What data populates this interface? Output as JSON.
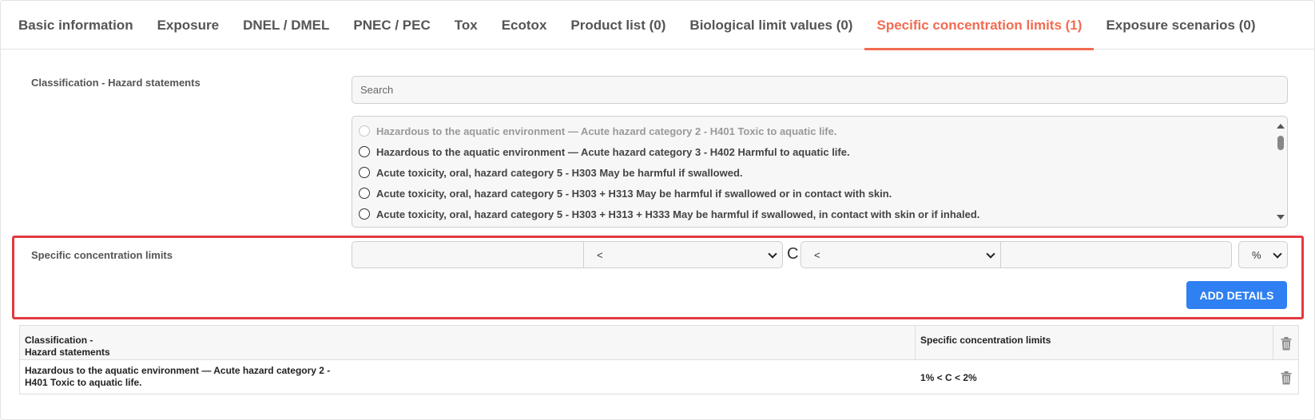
{
  "tabs": [
    {
      "label": "Basic information",
      "active": false
    },
    {
      "label": "Exposure",
      "active": false
    },
    {
      "label": "DNEL / DMEL",
      "active": false
    },
    {
      "label": "PNEC / PEC",
      "active": false
    },
    {
      "label": "Tox",
      "active": false
    },
    {
      "label": "Ecotox",
      "active": false
    },
    {
      "label": "Product list (0)",
      "active": false
    },
    {
      "label": "Biological limit values (0)",
      "active": false
    },
    {
      "label": "Specific concentration limits (1)",
      "active": true
    },
    {
      "label": "Exposure scenarios (0)",
      "active": false
    }
  ],
  "classification": {
    "label": "Classification - Hazard statements",
    "search_placeholder": "Search",
    "options": [
      {
        "text": "Hazardous to the aquatic environment — Acute hazard category 2 - H401 Toxic to aquatic life.",
        "disabled": true
      },
      {
        "text": "Hazardous to the aquatic environment — Acute hazard category 3 - H402 Harmful to aquatic life.",
        "disabled": false
      },
      {
        "text": "Acute toxicity, oral, hazard category 5 - H303 May be harmful if swallowed.",
        "disabled": false
      },
      {
        "text": "Acute toxicity, oral, hazard category 5 - H303 + H313 May be harmful if swallowed or in contact with skin.",
        "disabled": false
      },
      {
        "text": "Acute toxicity, oral, hazard category 5 - H303 + H313 + H333 May be harmful if swallowed, in contact with skin or if inhaled.",
        "disabled": false
      }
    ]
  },
  "limits": {
    "label": "Specific concentration limits",
    "lower_value": "",
    "lower_operator": "<",
    "c_label": "C",
    "upper_operator": "<",
    "upper_value": "",
    "unit": "%",
    "add_button": "ADD DETAILS"
  },
  "table": {
    "headers": {
      "classification_line1": "Classification -",
      "classification_line2": "Hazard statements",
      "limits": "Specific concentration limits"
    },
    "rows": [
      {
        "classification_line1": "Hazardous to the aquatic environment — Acute hazard category 2 -",
        "classification_line2": "H401 Toxic to aquatic life.",
        "limits": "1% < C < 2%"
      }
    ]
  },
  "icons": {
    "radio": "radio-icon",
    "trash": "trash-icon",
    "dropdown": "chevron-down-icon"
  },
  "colors": {
    "accent": "#f26b50",
    "primary_button": "#2f80f2",
    "highlight": "#e33a3f"
  }
}
